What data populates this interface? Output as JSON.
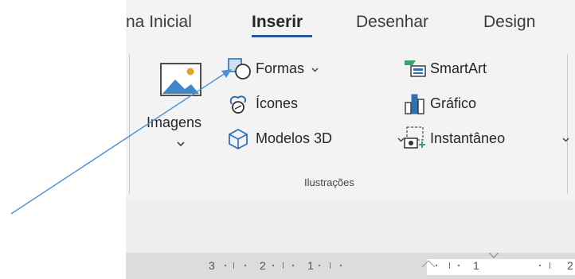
{
  "tabs": [
    {
      "label": "na Inicial",
      "active": false
    },
    {
      "label": "Inserir",
      "active": true
    },
    {
      "label": "Desenhar",
      "active": false
    },
    {
      "label": "Design",
      "active": false
    }
  ],
  "illustrations": {
    "images_label": "Imagens",
    "shapes_label": "Formas",
    "icons_label": "Ícones",
    "models3d_label": "Modelos 3D",
    "smartart_label": "SmartArt",
    "chart_label": "Gráfico",
    "screenshot_label": "Instantâneo",
    "group_label": "Ilustrações"
  },
  "ruler": {
    "marks_left": [
      "3",
      "2",
      "1"
    ],
    "marks_right": [
      "1",
      "2"
    ]
  },
  "colors": {
    "accent": "#2b579a",
    "ribbon_bg": "#f3f3f3",
    "arrow": "#4a90d9"
  }
}
